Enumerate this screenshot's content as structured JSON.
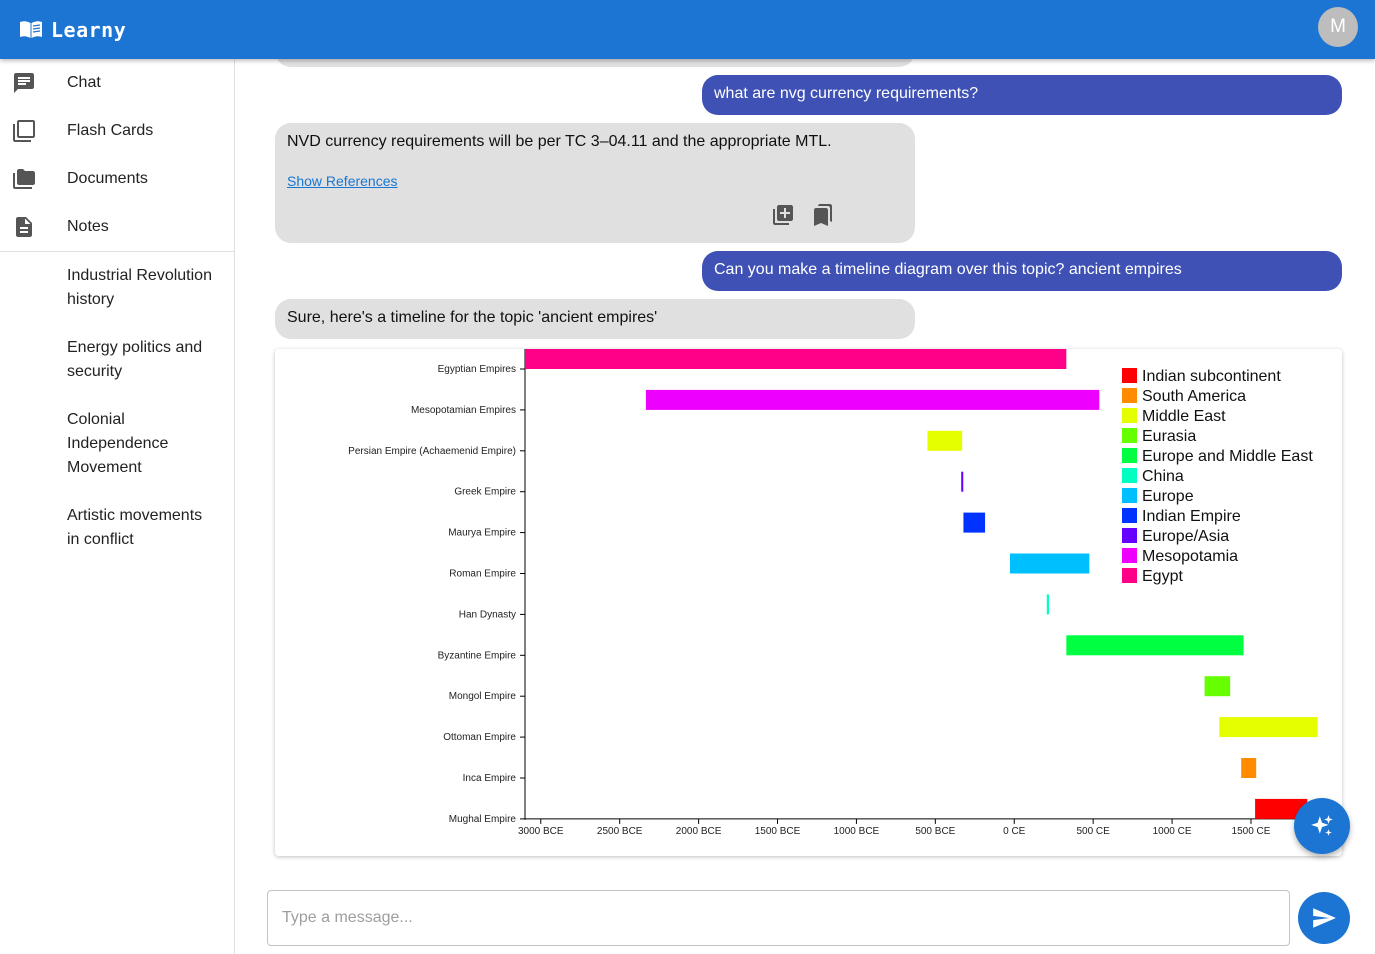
{
  "app": {
    "name": "Learny",
    "avatar_initial": "M"
  },
  "nav": [
    {
      "label": "Chat",
      "icon": "chat-icon"
    },
    {
      "label": "Flash Cards",
      "icon": "flash-cards-icon"
    },
    {
      "label": "Documents",
      "icon": "folder-icon"
    },
    {
      "label": "Notes",
      "icon": "notes-icon"
    }
  ],
  "topics": [
    "Industrial Revolution history",
    "Energy politics and security",
    "Colonial Independence Movement",
    "Artistic movements in conflict"
  ],
  "messages": {
    "user_1": "what are nvg currency requirements?",
    "bot_1": "NVD currency requirements will be per TC 3–04.11 and the appropriate MTL.",
    "show_references": "Show References",
    "user_2": "Can you make a timeline diagram over this topic? ancient empires",
    "bot_2": "Sure, here's a timeline for the topic 'ancient empires'"
  },
  "input": {
    "placeholder": "Type a message..."
  },
  "chart_data": {
    "type": "bar",
    "orientation": "horizontal-timeline",
    "x_ticks": [
      "3000 BCE",
      "2500 BCE",
      "2000 BCE",
      "1500 BCE",
      "1000 BCE",
      "500 BCE",
      "0 CE",
      "500 CE",
      "1000 CE",
      "1500 CE"
    ],
    "x_tick_values": [
      -3000,
      -2500,
      -2000,
      -1500,
      -1000,
      -500,
      0,
      500,
      1000,
      1500
    ],
    "xlim": [
      -3100,
      1950
    ],
    "legend_position": "top-right",
    "grid": false,
    "series": [
      {
        "category": "Egyptian Empires",
        "start": -3100,
        "end": 330,
        "region": "Egypt"
      },
      {
        "category": "Mesopotamian Empires",
        "start": -2334,
        "end": 539,
        "region": "Mesopotamia"
      },
      {
        "category": "Persian Empire (Achaemenid Empire)",
        "start": -550,
        "end": -330,
        "region": "Middle East"
      },
      {
        "category": "Greek Empire",
        "start": -336,
        "end": -323,
        "region": "Europe/Asia"
      },
      {
        "category": "Maurya Empire",
        "start": -322,
        "end": -185,
        "region": "Indian Empire"
      },
      {
        "category": "Roman Empire",
        "start": -27,
        "end": 476,
        "region": "Europe"
      },
      {
        "category": "Han Dynasty",
        "start": 206,
        "end": 220,
        "region": "China"
      },
      {
        "category": "Byzantine Empire",
        "start": 330,
        "end": 1453,
        "region": "Europe and Middle East"
      },
      {
        "category": "Mongol Empire",
        "start": 1206,
        "end": 1368,
        "region": "Eurasia"
      },
      {
        "category": "Ottoman Empire",
        "start": 1299,
        "end": 1922,
        "region": "Middle East"
      },
      {
        "category": "Inca Empire",
        "start": 1438,
        "end": 1533,
        "region": "South America"
      },
      {
        "category": "Mughal Empire",
        "start": 1526,
        "end": 1857,
        "region": "Indian subcontinent"
      }
    ],
    "legend": [
      {
        "name": "Indian subcontinent",
        "color": "#ff0000"
      },
      {
        "name": "South America",
        "color": "#ff8c00"
      },
      {
        "name": "Middle East",
        "color": "#e6ff00"
      },
      {
        "name": "Eurasia",
        "color": "#66ff00"
      },
      {
        "name": "Europe and Middle East",
        "color": "#00ff40"
      },
      {
        "name": "China",
        "color": "#00ffc0"
      },
      {
        "name": "Europe",
        "color": "#00bfff"
      },
      {
        "name": "Indian Empire",
        "color": "#0033ff"
      },
      {
        "name": "Europe/Asia",
        "color": "#6600ff"
      },
      {
        "name": "Mesopotamia",
        "color": "#ee00ff"
      },
      {
        "name": "Egypt",
        "color": "#ff0088"
      }
    ]
  }
}
